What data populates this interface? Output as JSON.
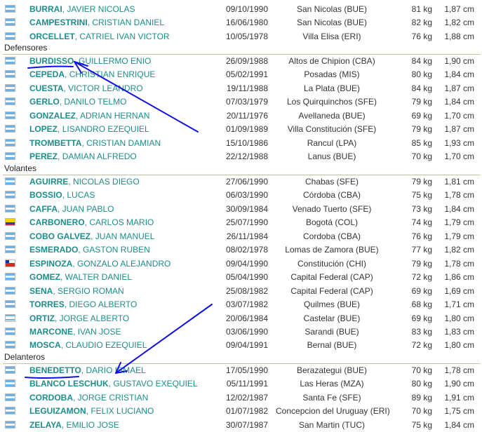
{
  "colors": {
    "player_link": "#1d8d8b",
    "annotation": "#1010e0",
    "separator": "#b9c7a0"
  },
  "groups": [
    {
      "label": "",
      "players": [
        {
          "surname": "BURRAI",
          "given": "JAVIER NICOLAS",
          "birth": "09/10/1990",
          "city": "San Nicolas (BUE)",
          "weight": "81 kg",
          "height": "1,87 cm",
          "flag": "ARG"
        },
        {
          "surname": "CAMPESTRINI",
          "given": "CRISTIAN DANIEL",
          "birth": "16/06/1980",
          "city": "San Nicolas (BUE)",
          "weight": "82 kg",
          "height": "1,82 cm",
          "flag": "ARG"
        },
        {
          "surname": "ORCELLET",
          "given": "CATRIEL IVAN VICTOR",
          "birth": "10/05/1978",
          "city": "Villa Elisa (ERI)",
          "weight": "76 kg",
          "height": "1,88 cm",
          "flag": "ARG"
        }
      ]
    },
    {
      "label": "Defensores",
      "players": [
        {
          "surname": "BURDISSO",
          "given": "GUILLERMO ENIO",
          "birth": "26/09/1988",
          "city": "Altos de Chipion (CBA)",
          "weight": "84 kg",
          "height": "1,90 cm",
          "flag": "ARG"
        },
        {
          "surname": "CEPEDA",
          "given": "CHRISTIAN ENRIQUE",
          "birth": "05/02/1991",
          "city": "Posadas (MIS)",
          "weight": "80 kg",
          "height": "1,84 cm",
          "flag": "ARG"
        },
        {
          "surname": "CUESTA",
          "given": "VICTOR LEANDRO",
          "birth": "19/11/1988",
          "city": "La Plata (BUE)",
          "weight": "84 kg",
          "height": "1,87 cm",
          "flag": "ARG"
        },
        {
          "surname": "GERLO",
          "given": "DANILO TELMO",
          "birth": "07/03/1979",
          "city": "Los Quirquinchos (SFE)",
          "weight": "79 kg",
          "height": "1,84 cm",
          "flag": "ARG"
        },
        {
          "surname": "GONZALEZ",
          "given": "ADRIAN HERNAN",
          "birth": "20/11/1976",
          "city": "Avellaneda (BUE)",
          "weight": "69 kg",
          "height": "1,70 cm",
          "flag": "ARG"
        },
        {
          "surname": "LOPEZ",
          "given": "LISANDRO EZEQUIEL",
          "birth": "01/09/1989",
          "city": "Villa Constitución (SFE)",
          "weight": "79 kg",
          "height": "1,87 cm",
          "flag": "ARG"
        },
        {
          "surname": "TROMBETTA",
          "given": "CRISTIAN DAMIAN",
          "birth": "15/10/1986",
          "city": "Rancul (LPA)",
          "weight": "85 kg",
          "height": "1,93 cm",
          "flag": "ARG"
        },
        {
          "surname": "PEREZ",
          "given": "DAMIAN ALFREDO",
          "birth": "22/12/1988",
          "city": "Lanus (BUE)",
          "weight": "70 kg",
          "height": "1,70 cm",
          "flag": "ARG"
        }
      ]
    },
    {
      "label": "Volantes",
      "players": [
        {
          "surname": "AGUIRRE",
          "given": "NICOLAS DIEGO",
          "birth": "27/06/1990",
          "city": "Chabas (SFE)",
          "weight": "79 kg",
          "height": "1,81 cm",
          "flag": "ARG"
        },
        {
          "surname": "BOSSIO",
          "given": "LUCAS",
          "birth": "06/03/1990",
          "city": "Córdoba (CBA)",
          "weight": "75 kg",
          "height": "1,78 cm",
          "flag": "ARG"
        },
        {
          "surname": "CAFFA",
          "given": "JUAN PABLO",
          "birth": "30/09/1984",
          "city": "Venado Tuerto (SFE)",
          "weight": "73 kg",
          "height": "1,84 cm",
          "flag": "ARG"
        },
        {
          "surname": "CARBONERO",
          "given": "CARLOS MARIO",
          "birth": "25/07/1990",
          "city": "Bogotá (COL)",
          "weight": "74 kg",
          "height": "1,79 cm",
          "flag": "COL"
        },
        {
          "surname": "COBO GALVEZ",
          "given": "JUAN MANUEL",
          "birth": "26/11/1984",
          "city": "Cordoba (CBA)",
          "weight": "76 kg",
          "height": "1,79 cm",
          "flag": "ARG"
        },
        {
          "surname": "ESMERADO",
          "given": "GASTON RUBEN",
          "birth": "08/02/1978",
          "city": "Lomas de Zamora (BUE)",
          "weight": "77 kg",
          "height": "1,82 cm",
          "flag": "ARG"
        },
        {
          "surname": "ESPINOZA",
          "given": "GONZALO ALEJANDRO",
          "birth": "09/04/1990",
          "city": "Constitución (CHI)",
          "weight": "79 kg",
          "height": "1,78 cm",
          "flag": "CHI"
        },
        {
          "surname": "GOMEZ",
          "given": "WALTER DANIEL",
          "birth": "05/04/1990",
          "city": "Capital Federal (CAP)",
          "weight": "72 kg",
          "height": "1,86 cm",
          "flag": "ARG"
        },
        {
          "surname": "SENA",
          "given": "SERGIO ROMAN",
          "birth": "25/08/1982",
          "city": "Capital Federal (CAP)",
          "weight": "69 kg",
          "height": "1,69 cm",
          "flag": "ARG"
        },
        {
          "surname": "TORRES",
          "given": "DIEGO ALBERTO",
          "birth": "03/07/1982",
          "city": "Quilmes (BUE)",
          "weight": "68 kg",
          "height": "1,71 cm",
          "flag": "ARG"
        },
        {
          "surname": "ORTIZ",
          "given": "JORGE ALBERTO",
          "birth": "20/06/1984",
          "city": "Castelar (BUE)",
          "weight": "69 kg",
          "height": "1,80 cm",
          "flag": "ARG"
        },
        {
          "surname": "MARCONE",
          "given": "IVAN JOSE",
          "birth": "03/06/1990",
          "city": "Sarandi (BUE)",
          "weight": "83 kg",
          "height": "1,83 cm",
          "flag": "ARG"
        },
        {
          "surname": "MOSCA",
          "given": "CLAUDIO EZEQUIEL",
          "birth": "09/04/1991",
          "city": "Bernal (BUE)",
          "weight": "72 kg",
          "height": "1,80 cm",
          "flag": "ARG"
        }
      ]
    },
    {
      "label": "Delanteros",
      "players": [
        {
          "surname": "BENEDETTO",
          "given": "DARIO ISMAEL",
          "birth": "17/05/1990",
          "city": "Berazategui (BUE)",
          "weight": "70 kg",
          "height": "1,78 cm",
          "flag": "ARG"
        },
        {
          "surname": "BLANCO LESCHUK",
          "given": "GUSTAVO EXEQUIEL",
          "birth": "05/11/1991",
          "city": "Las Heras (MZA)",
          "weight": "80 kg",
          "height": "1,90 cm",
          "flag": "ARG"
        },
        {
          "surname": "CORDOBA",
          "given": "JORGE CRISTIAN",
          "birth": "12/02/1987",
          "city": "Santa Fe (SFE)",
          "weight": "89 kg",
          "height": "1,91 cm",
          "flag": "ARG"
        },
        {
          "surname": "LEGUIZAMON",
          "given": "FELIX LUCIANO",
          "birth": "01/07/1982",
          "city": "Concepcion del Uruguay (ERI)",
          "weight": "70 kg",
          "height": "1,75 cm",
          "flag": "ARG"
        },
        {
          "surname": "ZELAYA",
          "given": "EMILIO JOSE",
          "birth": "30/07/1987",
          "city": "San Martin (TUC)",
          "weight": "75 kg",
          "height": "1,84 cm",
          "flag": "ARG"
        }
      ]
    }
  ]
}
